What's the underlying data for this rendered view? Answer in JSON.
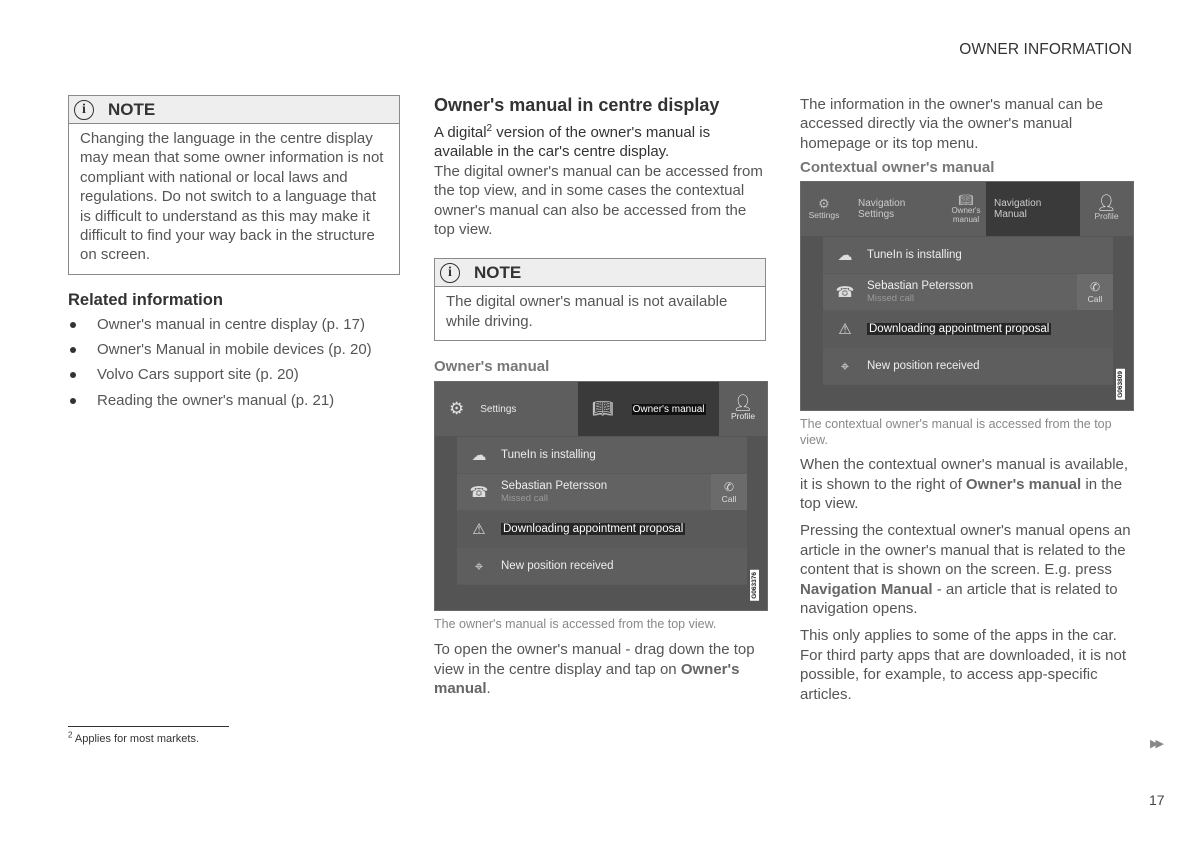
{
  "header": {
    "section_title": "OWNER INFORMATION"
  },
  "col1": {
    "note": {
      "icon": "info-icon",
      "title": "NOTE",
      "body": "Changing the language in the centre display may mean that some owner information is not compliant with national or local laws and regulations. Do not switch to a language that is difficult to understand as this may make it difficult to find your way back in the structure on screen."
    },
    "related": {
      "heading": "Related information",
      "items": [
        {
          "label": "Owner's manual in centre display (p. 17)"
        },
        {
          "label": "Owner's Manual in mobile devices (p. 20)"
        },
        {
          "label": "Volvo Cars support site (p. 20)"
        },
        {
          "label": "Reading the owner's manual (p. 21)"
        }
      ]
    }
  },
  "col2": {
    "heading": "Owner's manual in centre display",
    "intro_before": "A digital",
    "intro_sup": "2",
    "intro_after": " version of the owner's manual is available in the car's centre display.",
    "para1": "The digital owner's manual can be accessed from the top view, and in some cases the contextual owner's manual can also be accessed from the top view.",
    "note": {
      "icon": "info-icon",
      "title": "NOTE",
      "body": "The digital owner's manual is not available while driving."
    },
    "subheading": "Owner's manual",
    "screen": {
      "topbar": {
        "settings": "Settings",
        "owners_manual": "Owner's manual",
        "profile": "Profile"
      },
      "notifications": [
        {
          "icon": "cloud-download-icon",
          "title": "TuneIn is installing"
        },
        {
          "icon": "missed-call-icon",
          "title": "Sebastian Petersson",
          "subtitle": "Missed call",
          "action": "Call"
        },
        {
          "icon": "warning-icon",
          "title": "Downloading appointment proposal"
        },
        {
          "icon": "position-icon",
          "title": "New position received"
        }
      ],
      "image_code": "G063376"
    },
    "caption": "The owner's manual is accessed from the top view.",
    "para2_before": "To open the owner's manual - drag down the top view in the centre display and tap on ",
    "para2_bold": "Owner's manual",
    "para2_after": "."
  },
  "col3": {
    "para1": "The information in the owner's manual can be accessed directly via the owner's manual homepage or its top menu.",
    "subheading": "Contextual owner's manual",
    "screen": {
      "topbar": {
        "settings": "Settings",
        "nav_settings_1": "Navigation",
        "nav_settings_2": "Settings",
        "owners_manual_1": "Owner's",
        "owners_manual_2": "manual",
        "nav_manual_1": "Navigation",
        "nav_manual_2": "Manual",
        "profile": "Profile"
      },
      "notifications": [
        {
          "icon": "cloud-download-icon",
          "title": "TuneIn is installing"
        },
        {
          "icon": "missed-call-icon",
          "title": "Sebastian Petersson",
          "subtitle": "Missed call",
          "action": "Call"
        },
        {
          "icon": "warning-icon",
          "title": "Downloading appointment proposal"
        },
        {
          "icon": "position-icon",
          "title": "New position received"
        }
      ],
      "image_code": "G063809"
    },
    "caption": "The contextual owner's manual is accessed from the top view.",
    "para2_before": "When the contextual owner's manual is available, it is shown to the right of ",
    "para2_bold": "Owner's manual",
    "para2_after": " in the top view.",
    "para3_before": "Pressing the contextual owner's manual opens an article in the owner's manual that is related to the content that is shown on the screen. E.g. press ",
    "para3_bold": "Navigation Manual",
    "para3_after": " - an article that is related to navigation opens.",
    "para4": "This only applies to some of the apps in the car. For third party apps that are downloaded, it is not possible, for example, to access app-specific articles."
  },
  "footer": {
    "footnote_num": "2",
    "footnote_text": " Applies for most markets.",
    "continue_icon": "double-arrow-right-icon",
    "continue_glyph": "▶▶",
    "page_number": "17"
  }
}
